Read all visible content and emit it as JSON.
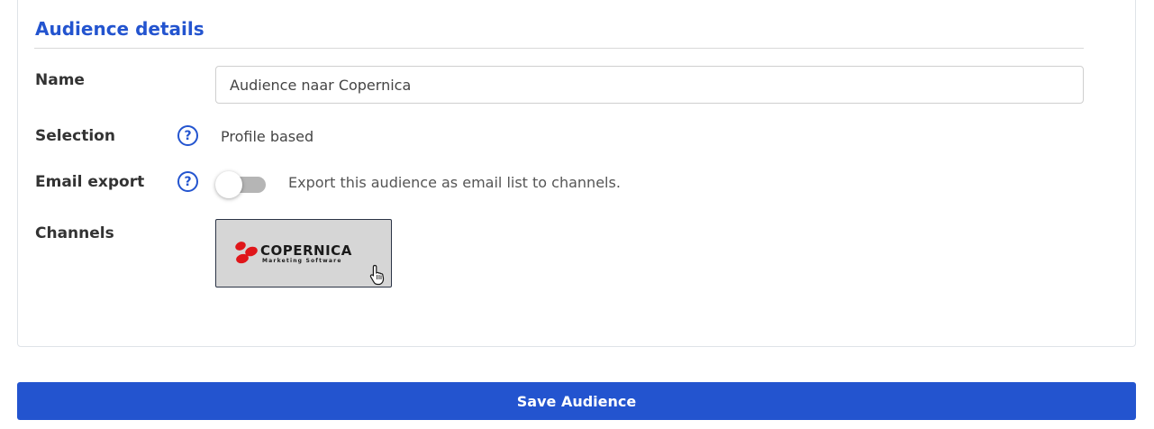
{
  "section": {
    "title": "Audience details"
  },
  "fields": {
    "name": {
      "label": "Name",
      "value": "Audience naar Copernica",
      "placeholder": ""
    },
    "selection": {
      "label": "Selection",
      "help_icon": "question-circle-icon",
      "value": "Profile based"
    },
    "email_export": {
      "label": "Email export",
      "help_icon": "question-circle-icon",
      "toggle_on": false,
      "description": "Export this audience as email list to channels."
    },
    "channels": {
      "label": "Channels",
      "items": [
        {
          "name": "COPERNICA",
          "tagline": "Marketing Software",
          "selected": true,
          "logo_color": "#e0161a"
        }
      ]
    }
  },
  "actions": {
    "save_label": "Save Audience"
  },
  "colors": {
    "accent": "#2354cf",
    "toggle_off": "#b5b5b5",
    "tile_bg": "#d6d6d6"
  }
}
